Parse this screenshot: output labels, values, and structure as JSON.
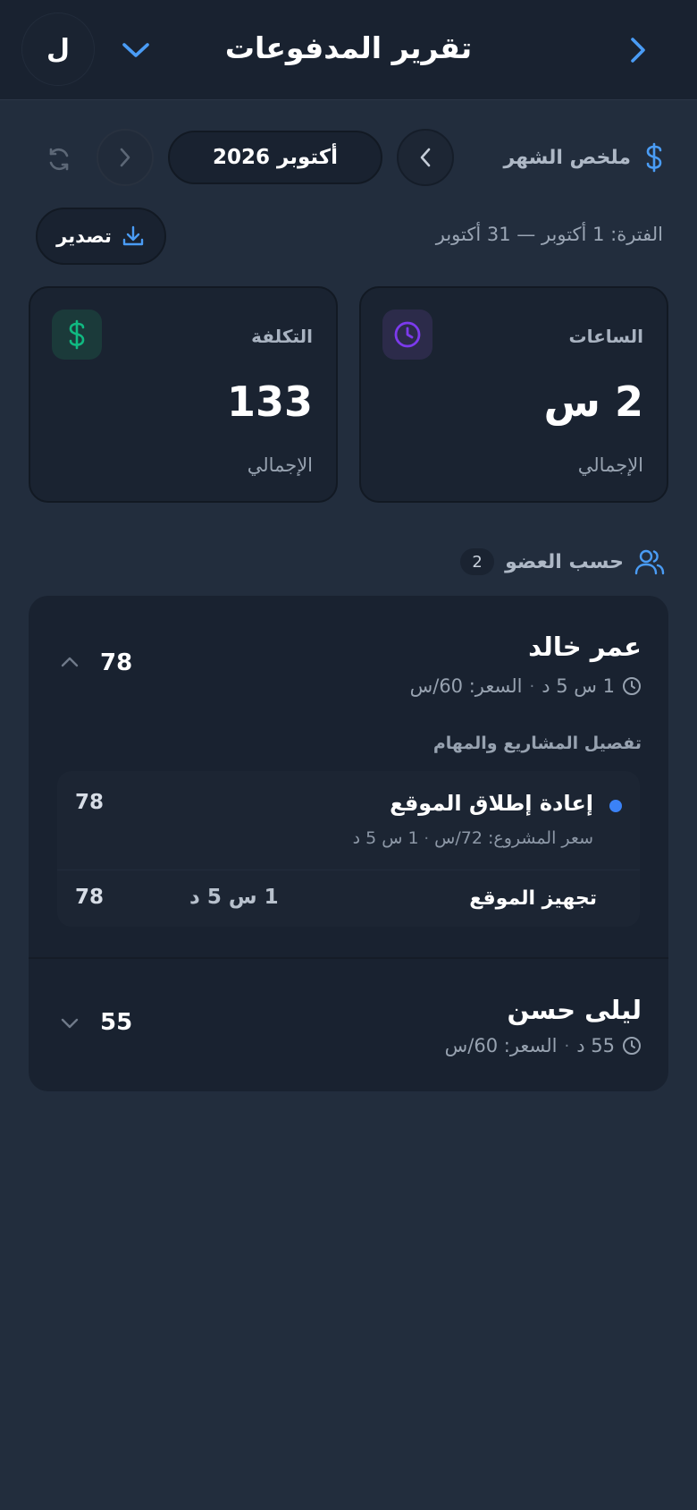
{
  "header": {
    "title": "تقرير المدفوعات",
    "avatar_letter": "ل"
  },
  "summary": {
    "label": "ملخص الشهر",
    "month": "أكتوبر 2026",
    "period": "الفترة: 1 أكتوبر — 31 أكتوبر",
    "export_label": "تصدير"
  },
  "stats": {
    "hours": {
      "label": "الساعات",
      "value": "2 س",
      "sub": "الإجمالي"
    },
    "cost": {
      "label": "التكلفة",
      "value": "133",
      "sub": "الإجمالي"
    }
  },
  "members_section": {
    "title": "حسب العضو",
    "count": "2"
  },
  "members": [
    {
      "name": "عمر خالد",
      "time": "1 س 5 د",
      "rate": "السعر: 60/س",
      "total": "78",
      "breakdown_title": "تفصيل المشاريع والمهام",
      "project": {
        "name": "إعادة إطلاق الموقع",
        "rate": "سعر المشروع: 72/س",
        "time": "1 س 5 د",
        "total": "78",
        "task": {
          "name": "تجهيز الموقع",
          "time": "1 س 5 د",
          "total": "78"
        }
      }
    },
    {
      "name": "ليلى حسن",
      "time": "55 د",
      "rate": "السعر: 60/س",
      "total": "55"
    }
  ],
  "colors": {
    "accent": "#3b82f6",
    "hours_icon": "#7c3aed",
    "cost_icon": "#10b981",
    "background": "#222d3d",
    "header": "#192230"
  }
}
